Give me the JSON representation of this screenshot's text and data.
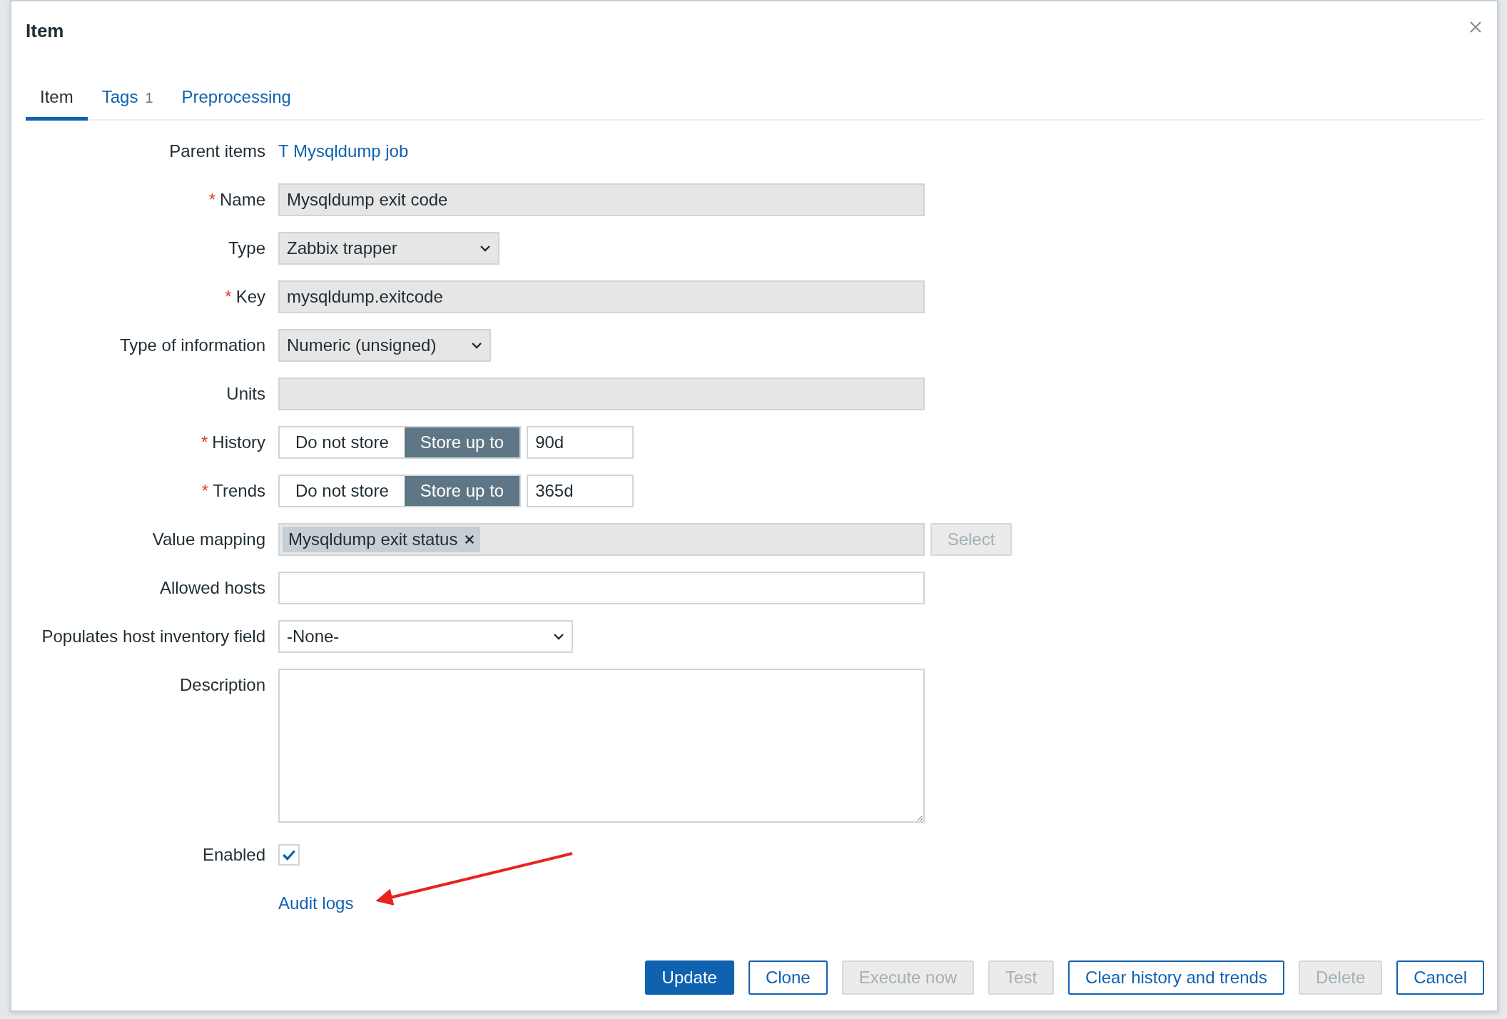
{
  "dialog": {
    "title": "Item"
  },
  "tabs": [
    {
      "label": "Item",
      "selected": true
    },
    {
      "label": "Tags",
      "badge": "1",
      "selected": false
    },
    {
      "label": "Preprocessing",
      "selected": false
    }
  ],
  "fields": [
    {
      "kind": "link",
      "label": "Parent items",
      "value": "T Mysqldump job"
    },
    {
      "kind": "text",
      "label": "Name",
      "marker": "*",
      "value": "Mysqldump exit code",
      "readonly": true
    },
    {
      "kind": "select",
      "label": "Type",
      "value": "Zabbix trapper",
      "readonly": true
    },
    {
      "kind": "text",
      "label": "Key",
      "marker": "*",
      "value": "mysqldump.exitcode",
      "readonly": true
    },
    {
      "kind": "select",
      "label": "Type of information",
      "value": "Numeric (unsigned)",
      "readonly": true
    },
    {
      "kind": "text",
      "label": "Units",
      "readonly": true
    },
    {
      "kind": "segmented",
      "label": "History",
      "marker": "*",
      "options": [
        {
          "label": "Do not store",
          "selected": false
        },
        {
          "label": "Store up to",
          "selected": true
        }
      ],
      "value": "90d"
    },
    {
      "kind": "segmented",
      "label": "Trends",
      "marker": "*",
      "options": [
        {
          "label": "Do not store",
          "selected": false
        },
        {
          "label": "Store up to",
          "selected": true
        }
      ],
      "value": "365d"
    },
    {
      "kind": "tags",
      "label": "Value mapping",
      "tags": [
        "Mysqldump exit status"
      ],
      "button": "Select"
    },
    {
      "kind": "text",
      "label": "Allowed hosts",
      "readonly": false
    },
    {
      "kind": "select",
      "label": "Populates host inventory field",
      "value": "-None-",
      "readonly": false
    },
    {
      "kind": "textarea",
      "label": "Description"
    },
    {
      "kind": "checkbox",
      "label": "Enabled",
      "checked": true
    },
    {
      "kind": "link",
      "value": "Audit logs"
    }
  ],
  "buttons": [
    {
      "label": "Update",
      "kind": "primary",
      "disabled": false
    },
    {
      "label": "Clone",
      "kind": "secondary",
      "disabled": false
    },
    {
      "label": "Execute now",
      "kind": "secondary",
      "disabled": true
    },
    {
      "label": "Test",
      "kind": "secondary",
      "disabled": true
    },
    {
      "label": "Clear history and trends",
      "kind": "secondary",
      "disabled": false
    },
    {
      "label": "Delete",
      "kind": "secondary",
      "disabled": true
    },
    {
      "label": "Cancel",
      "kind": "secondary",
      "disabled": false
    }
  ]
}
